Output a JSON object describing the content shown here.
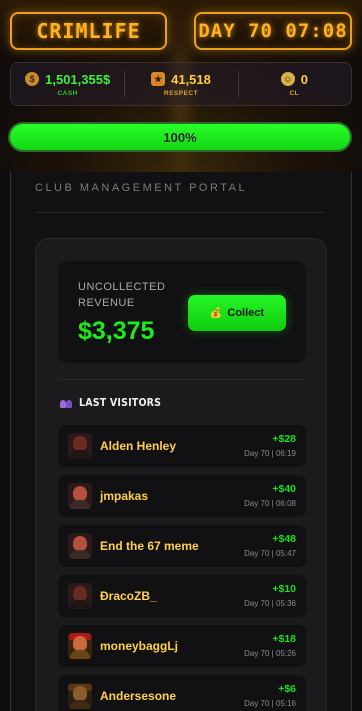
{
  "header": {
    "logo_text": "CRIMLIFE",
    "day_time": "DAY 70 07:08"
  },
  "stats": [
    {
      "id": "cash",
      "value": "1,501,355$",
      "label": "CASH",
      "icon": "money-bag-icon"
    },
    {
      "id": "respect",
      "value": "41,518",
      "label": "RESPECT",
      "icon": "medal-icon"
    },
    {
      "id": "cl",
      "value": "0",
      "label": "CL",
      "icon": "face-icon"
    }
  ],
  "progress": {
    "value": 1.0,
    "label": "100%"
  },
  "portal": {
    "title": "CLUB MANAGEMENT PORTAL",
    "revenue_label": "UNCOLLECTED REVENUE",
    "revenue_amount": "$3,375",
    "collect_icon": "💰",
    "collect_label": "Collect",
    "visitors_title": "LAST VISITORS"
  },
  "visitors": [
    {
      "name": "Alden Henley",
      "amount": "+$28",
      "time": "Day 70 | 06:19",
      "avatar": "dark"
    },
    {
      "name": "jmpakas",
      "amount": "+$40",
      "time": "Day 70 | 06:08",
      "avatar": "red"
    },
    {
      "name": "End the 67 meme",
      "amount": "+$48",
      "time": "Day 70 | 05:47",
      "avatar": "red"
    },
    {
      "name": "ĐracoZB_",
      "amount": "+$10",
      "time": "Day 70 | 05:36",
      "avatar": "dark"
    },
    {
      "name": "moneybaggLj",
      "amount": "+$18",
      "time": "Day 70 | 05:26",
      "avatar": "pirate"
    },
    {
      "name": "Andersesone",
      "amount": "+$6",
      "time": "Day 70 | 05:16",
      "avatar": "cowboy"
    }
  ],
  "colors": {
    "accent_gold": "#ffb21e",
    "money_green": "#19ec19",
    "name_yellow": "#ffd04a"
  }
}
